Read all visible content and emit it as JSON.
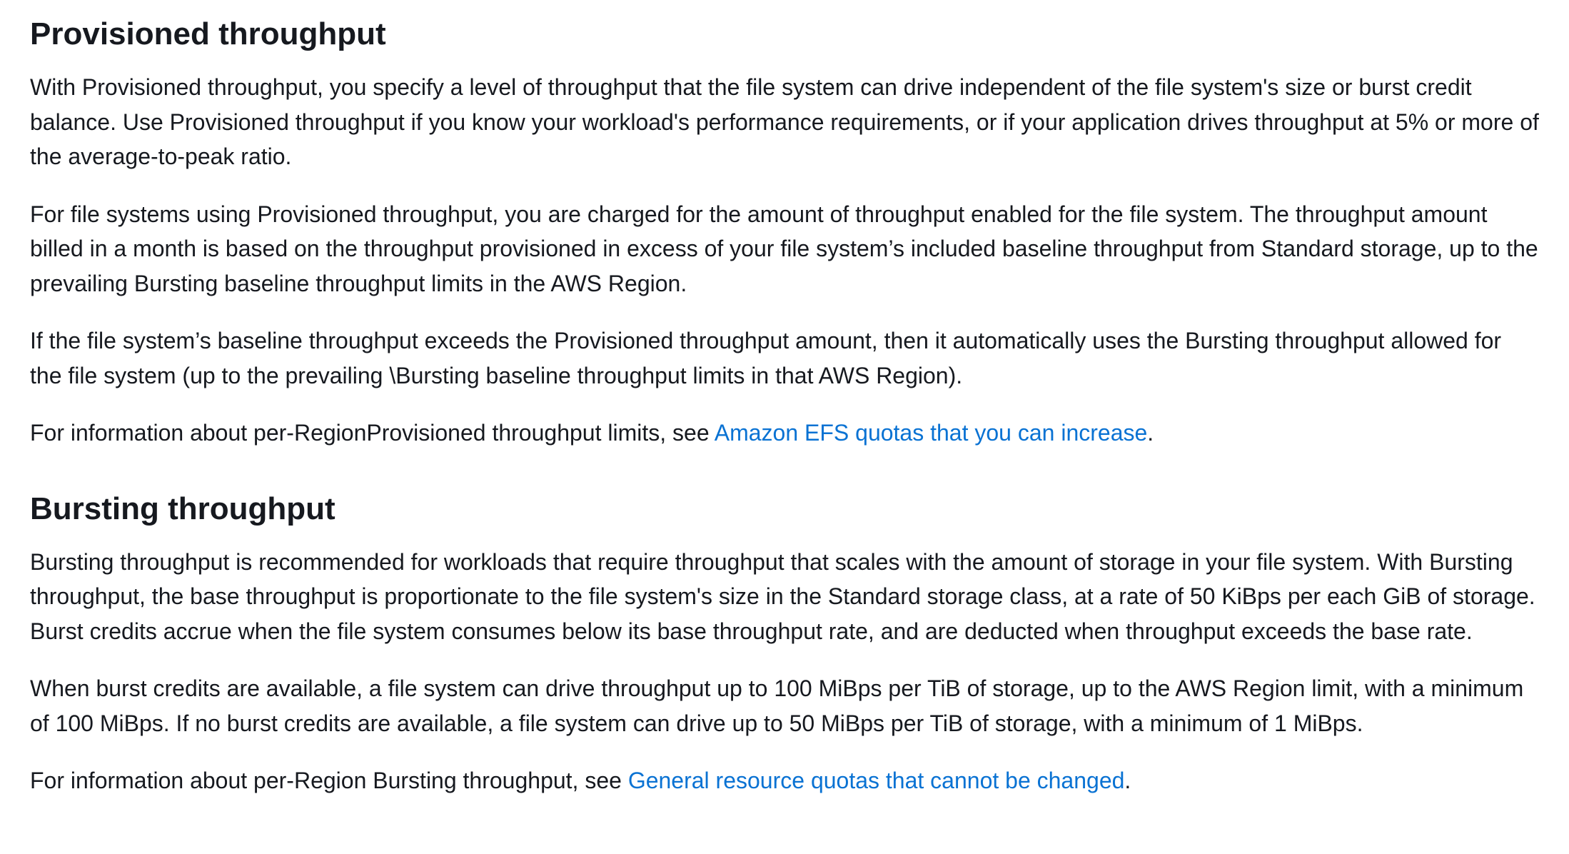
{
  "provisioned": {
    "heading": "Provisioned throughput",
    "paragraphs": [
      "With Provisioned throughput, you specify a level of throughput that the file system can drive independent of the file system's size or burst credit balance. Use Provisioned throughput if you know your workload's performance requirements, or if your application drives throughput at 5% or more of the average-to-peak ratio.",
      "For file systems using Provisioned throughput, you are charged for the amount of throughput enabled for the file system. The throughput amount billed in a month is based on the throughput provisioned in excess of your file system’s included baseline throughput from Standard storage, up to the prevailing Bursting baseline throughput limits in the AWS Region.",
      "If the file system’s baseline throughput exceeds the Provisioned throughput amount, then it automatically uses the Bursting throughput allowed for the file system (up to the prevailing \\Bursting baseline throughput limits in that AWS Region)."
    ],
    "info_prefix": "For information about per-RegionProvisioned throughput limits, see ",
    "info_link": "Amazon EFS quotas that you can increase",
    "info_suffix": "."
  },
  "bursting": {
    "heading": "Bursting throughput",
    "paragraphs": [
      "Bursting throughput is recommended for workloads that require throughput that scales with the amount of storage in your file system. With Bursting throughput, the base throughput is proportionate to the file system's size in the Standard storage class, at a rate of 50 KiBps per each GiB of storage. Burst credits accrue when the file system consumes below its base throughput rate, and are deducted when throughput exceeds the base rate.",
      "When burst credits are available, a file system can drive throughput up to 100 MiBps per TiB of storage, up to the AWS Region limit, with a minimum of 100 MiBps. If no burst credits are available, a file system can drive up to 50 MiBps per TiB of storage, with a minimum of 1 MiBps."
    ],
    "info_prefix": "For information about per-Region Bursting throughput, see ",
    "info_link": "General resource quotas that cannot be changed",
    "info_suffix": "."
  },
  "colors": {
    "text": "#16191f",
    "link": "#0972d3"
  }
}
